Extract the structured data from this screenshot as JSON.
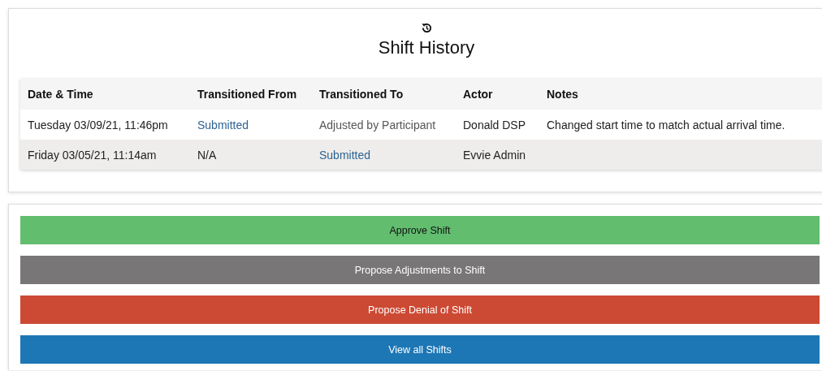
{
  "history": {
    "title": "Shift History",
    "columns": [
      "Date & Time",
      "Transitioned From",
      "Transitioned To",
      "Actor",
      "Notes"
    ],
    "rows": [
      {
        "cells": [
          {
            "text": "Tuesday 03/09/21, 11:46pm",
            "kind": "plain"
          },
          {
            "text": "Submitted",
            "kind": "link"
          },
          {
            "text": "Adjusted by Participant",
            "kind": "muted"
          },
          {
            "text": "Donald DSP",
            "kind": "plain"
          },
          {
            "text": "Changed start time to match actual arrival time.",
            "kind": "plain"
          }
        ]
      },
      {
        "cells": [
          {
            "text": "Friday 03/05/21, 11:14am",
            "kind": "plain"
          },
          {
            "text": "N/A",
            "kind": "plain"
          },
          {
            "text": "Submitted",
            "kind": "link"
          },
          {
            "text": "Evvie Admin",
            "kind": "plain"
          }
        ]
      }
    ]
  },
  "actions": [
    {
      "label": "Approve Shift",
      "kind": "approve"
    },
    {
      "label": "Propose Adjustments to Shift",
      "kind": "adjust"
    },
    {
      "label": "Propose Denial of Shift",
      "kind": "deny"
    },
    {
      "label": "View all Shifts",
      "kind": "view"
    }
  ]
}
